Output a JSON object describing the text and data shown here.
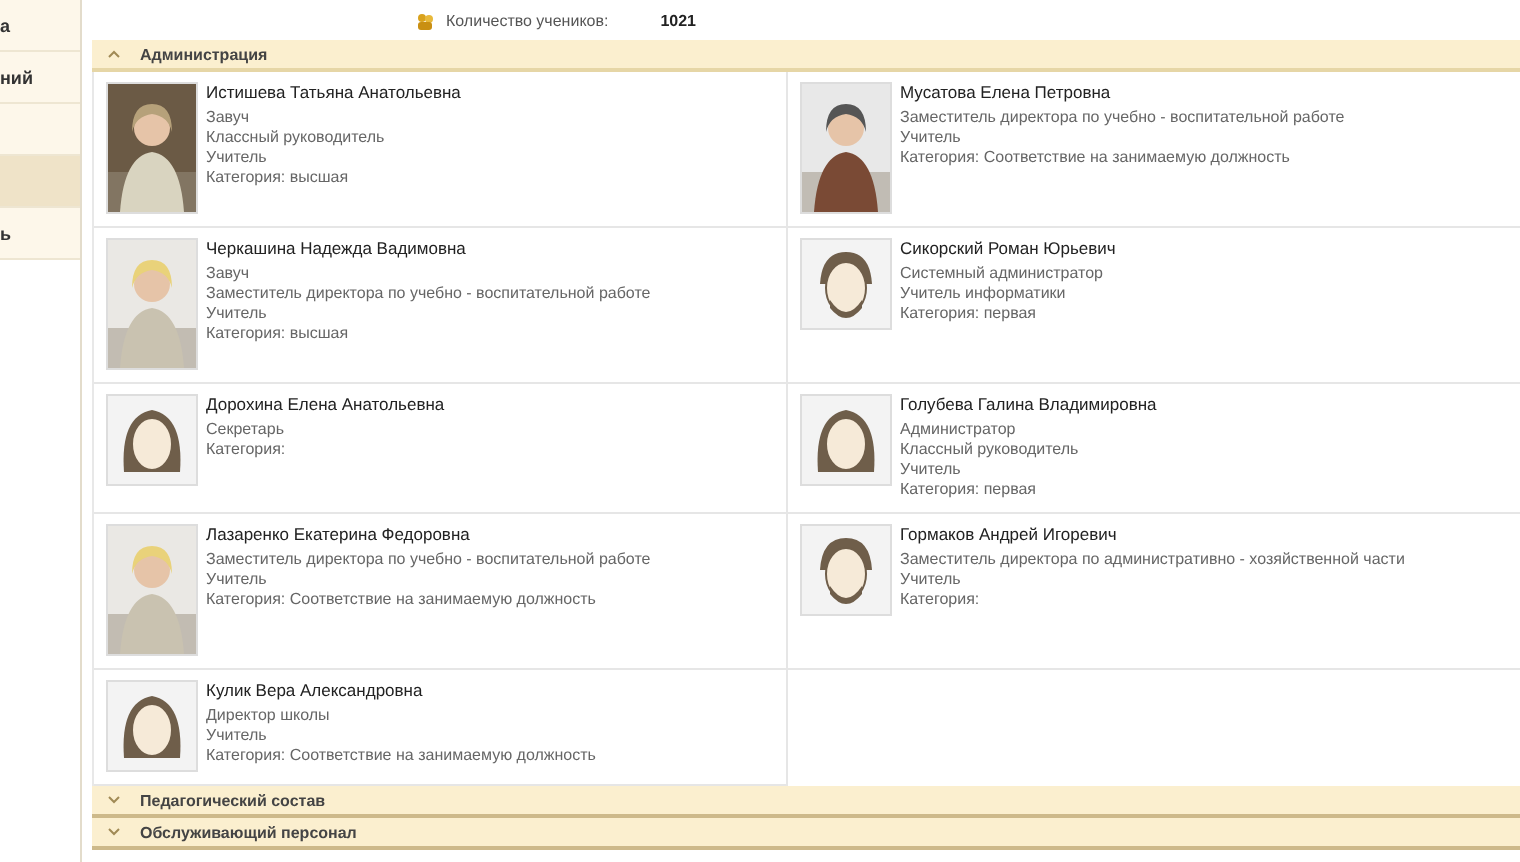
{
  "sidebar": {
    "items": [
      {
        "label": "а",
        "selected": false
      },
      {
        "label": "ний",
        "selected": false
      },
      {
        "selected": false
      },
      {
        "selected": true
      },
      {
        "label": "ь",
        "selected": false
      }
    ]
  },
  "summary": {
    "label": "Количество учеников:",
    "value": "1021"
  },
  "sections": [
    {
      "title": "Администрация",
      "expanded": true,
      "people": [
        {
          "name": "Истишева Татьяна Анатольевна",
          "lines": [
            "Завуч",
            "Классный руководитель",
            "Учитель",
            "Категория: высшая"
          ],
          "kind": "picture"
        },
        {
          "name": "Мусатова Елена Петровна",
          "lines": [
            "Заместитель директора по учебно - воспитательной работе",
            "Учитель",
            "Категория: Соответствие на занимаемую должность"
          ],
          "kind": "picture"
        },
        {
          "name": "Черкашина Надежда Вадимовна",
          "lines": [
            "Завуч",
            "Заместитель директора по учебно - воспитательной работе",
            "Учитель",
            "Категория: высшая"
          ],
          "kind": "picture"
        },
        {
          "name": "Сикорский Роман Юрьевич",
          "lines": [
            "Системный администратор",
            "Учитель информатики",
            "Категория: первая"
          ],
          "kind": "man"
        },
        {
          "name": "Дорохина Елена Анатольевна",
          "lines": [
            "Секретарь",
            "Категория:"
          ],
          "kind": "woman"
        },
        {
          "name": "Голубева Галина Владимировна",
          "lines": [
            "Администратор",
            "Классный руководитель",
            "Учитель",
            "Категория: первая"
          ],
          "kind": "woman"
        },
        {
          "name": "Лазаренко Екатерина Федоровна",
          "lines": [
            "Заместитель директора по учебно - воспитательной работе",
            "Учитель",
            "Категория: Соответствие на занимаемую должность"
          ],
          "kind": "picture"
        },
        {
          "name": "Гормаков Андрей Игоревич",
          "lines": [
            "Заместитель директора по административно - хозяйственной части",
            "Учитель",
            "Категория:"
          ],
          "kind": "man"
        },
        {
          "name": "Кулик Вера Александровна",
          "lines": [
            "Директор школы",
            "Учитель",
            "Категория: Соответствие на занимаемую должность"
          ],
          "kind": "woman"
        }
      ]
    },
    {
      "title": "Педагогический состав",
      "expanded": false
    },
    {
      "title": "Обслуживающий персонал",
      "expanded": false
    }
  ]
}
